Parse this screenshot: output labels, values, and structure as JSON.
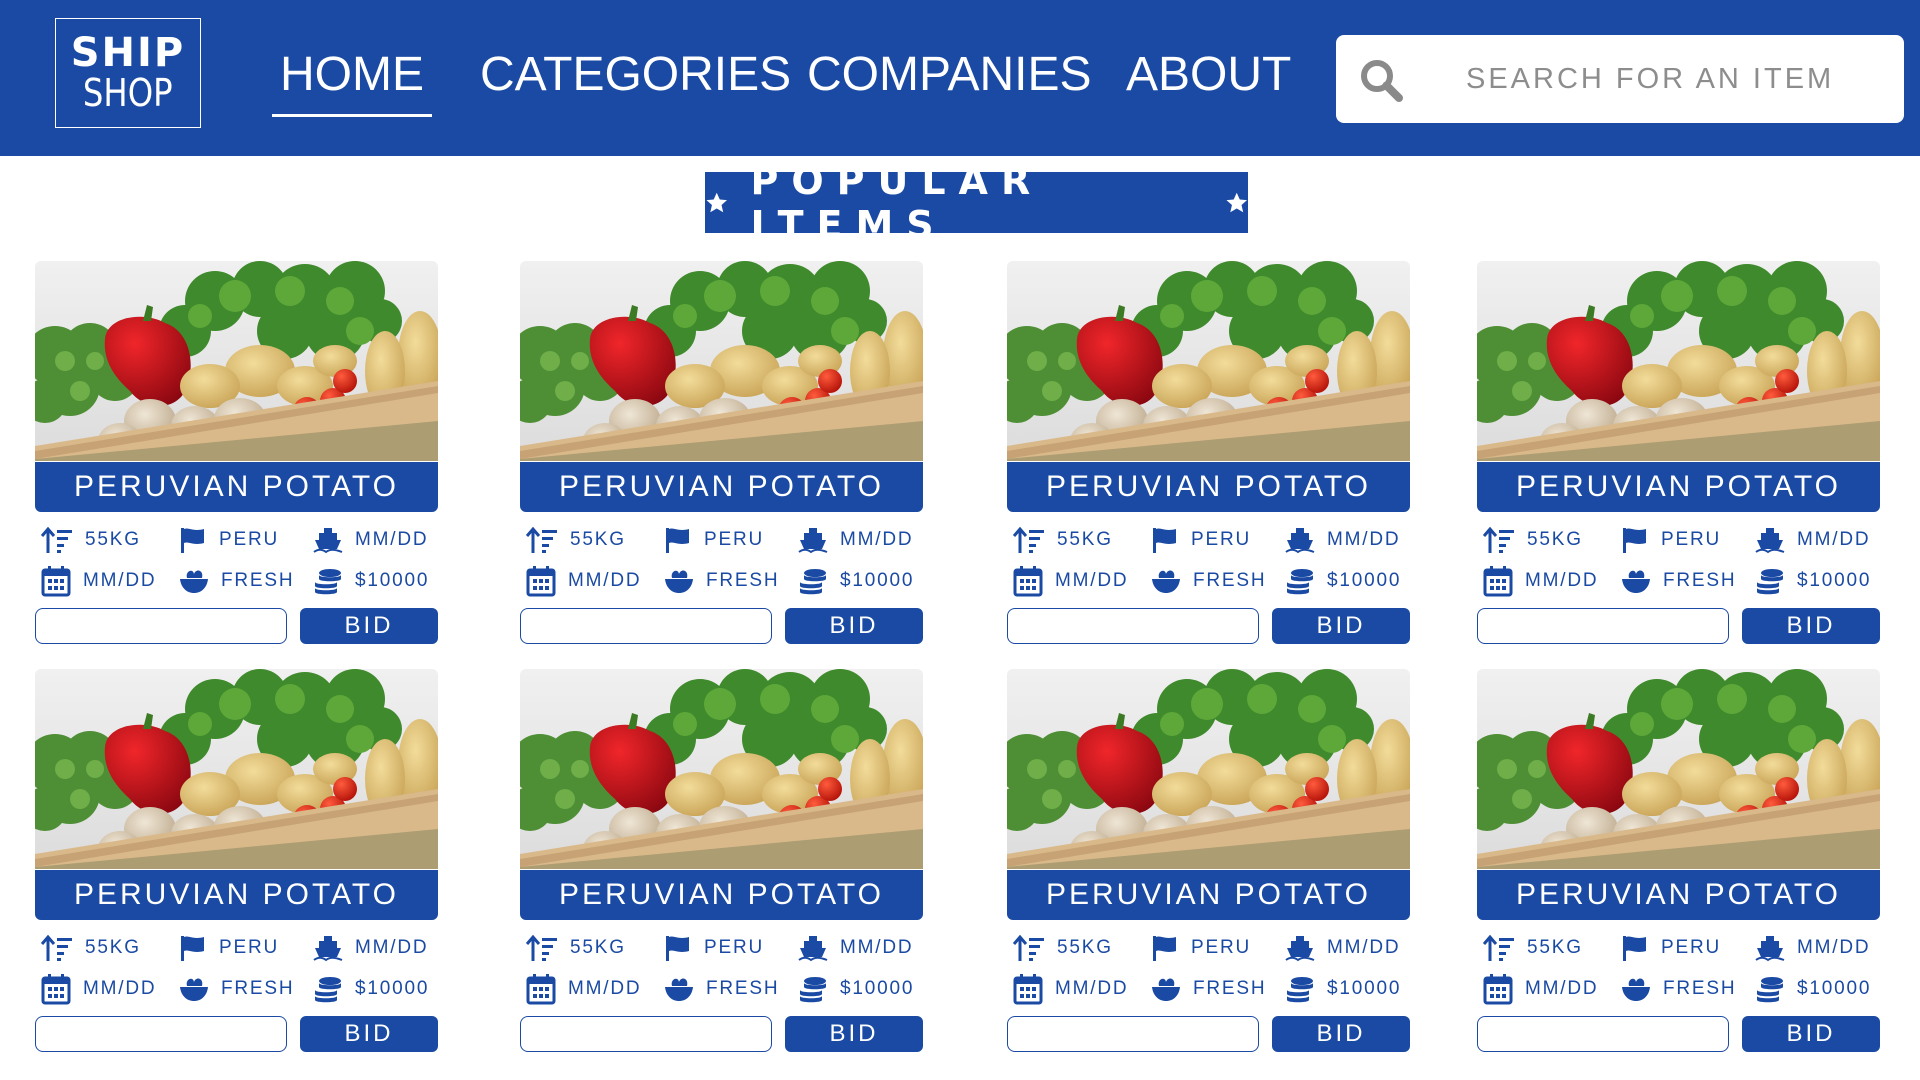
{
  "header": {
    "logo_top": "SHIP",
    "logo_bottom": "SHOP",
    "nav": [
      {
        "label": "HOME",
        "active": true
      },
      {
        "label": "CATEGORIES",
        "active": false
      },
      {
        "label": "COMPANIES",
        "active": false
      },
      {
        "label": "ABOUT",
        "active": false
      }
    ],
    "search_placeholder": "SEARCH FOR AN ITEM"
  },
  "section": {
    "title": "POPULAR ITEMS"
  },
  "colors": {
    "primary": "#1a4aa3",
    "background": "#ffffff"
  },
  "items": [
    {
      "name": "PERUVIAN POTATO",
      "weight": "55KG",
      "origin": "PERU",
      "ship_date": "MM/DD",
      "date": "MM/DD",
      "condition": "FRESH",
      "price": "$10000",
      "bid_label": "BID"
    },
    {
      "name": "PERUVIAN POTATO",
      "weight": "55KG",
      "origin": "PERU",
      "ship_date": "MM/DD",
      "date": "MM/DD",
      "condition": "FRESH",
      "price": "$10000",
      "bid_label": "BID"
    },
    {
      "name": "PERUVIAN POTATO",
      "weight": "55KG",
      "origin": "PERU",
      "ship_date": "MM/DD",
      "date": "MM/DD",
      "condition": "FRESH",
      "price": "$10000",
      "bid_label": "BID"
    },
    {
      "name": "PERUVIAN POTATO",
      "weight": "55KG",
      "origin": "PERU",
      "ship_date": "MM/DD",
      "date": "MM/DD",
      "condition": "FRESH",
      "price": "$10000",
      "bid_label": "BID"
    },
    {
      "name": "PERUVIAN POTATO",
      "weight": "55KG",
      "origin": "PERU",
      "ship_date": "MM/DD",
      "date": "MM/DD",
      "condition": "FRESH",
      "price": "$10000",
      "bid_label": "BID"
    },
    {
      "name": "PERUVIAN POTATO",
      "weight": "55KG",
      "origin": "PERU",
      "ship_date": "MM/DD",
      "date": "MM/DD",
      "condition": "FRESH",
      "price": "$10000",
      "bid_label": "BID"
    },
    {
      "name": "PERUVIAN POTATO",
      "weight": "55KG",
      "origin": "PERU",
      "ship_date": "MM/DD",
      "date": "MM/DD",
      "condition": "FRESH",
      "price": "$10000",
      "bid_label": "BID"
    },
    {
      "name": "PERUVIAN POTATO",
      "weight": "55KG",
      "origin": "PERU",
      "ship_date": "MM/DD",
      "date": "MM/DD",
      "condition": "FRESH",
      "price": "$10000",
      "bid_label": "BID"
    }
  ],
  "icons": {
    "weight": "sort-weight-icon",
    "origin": "flag-icon",
    "ship_date": "ship-icon",
    "date": "calendar-icon",
    "condition": "salad-bowl-icon",
    "price": "coins-icon"
  }
}
